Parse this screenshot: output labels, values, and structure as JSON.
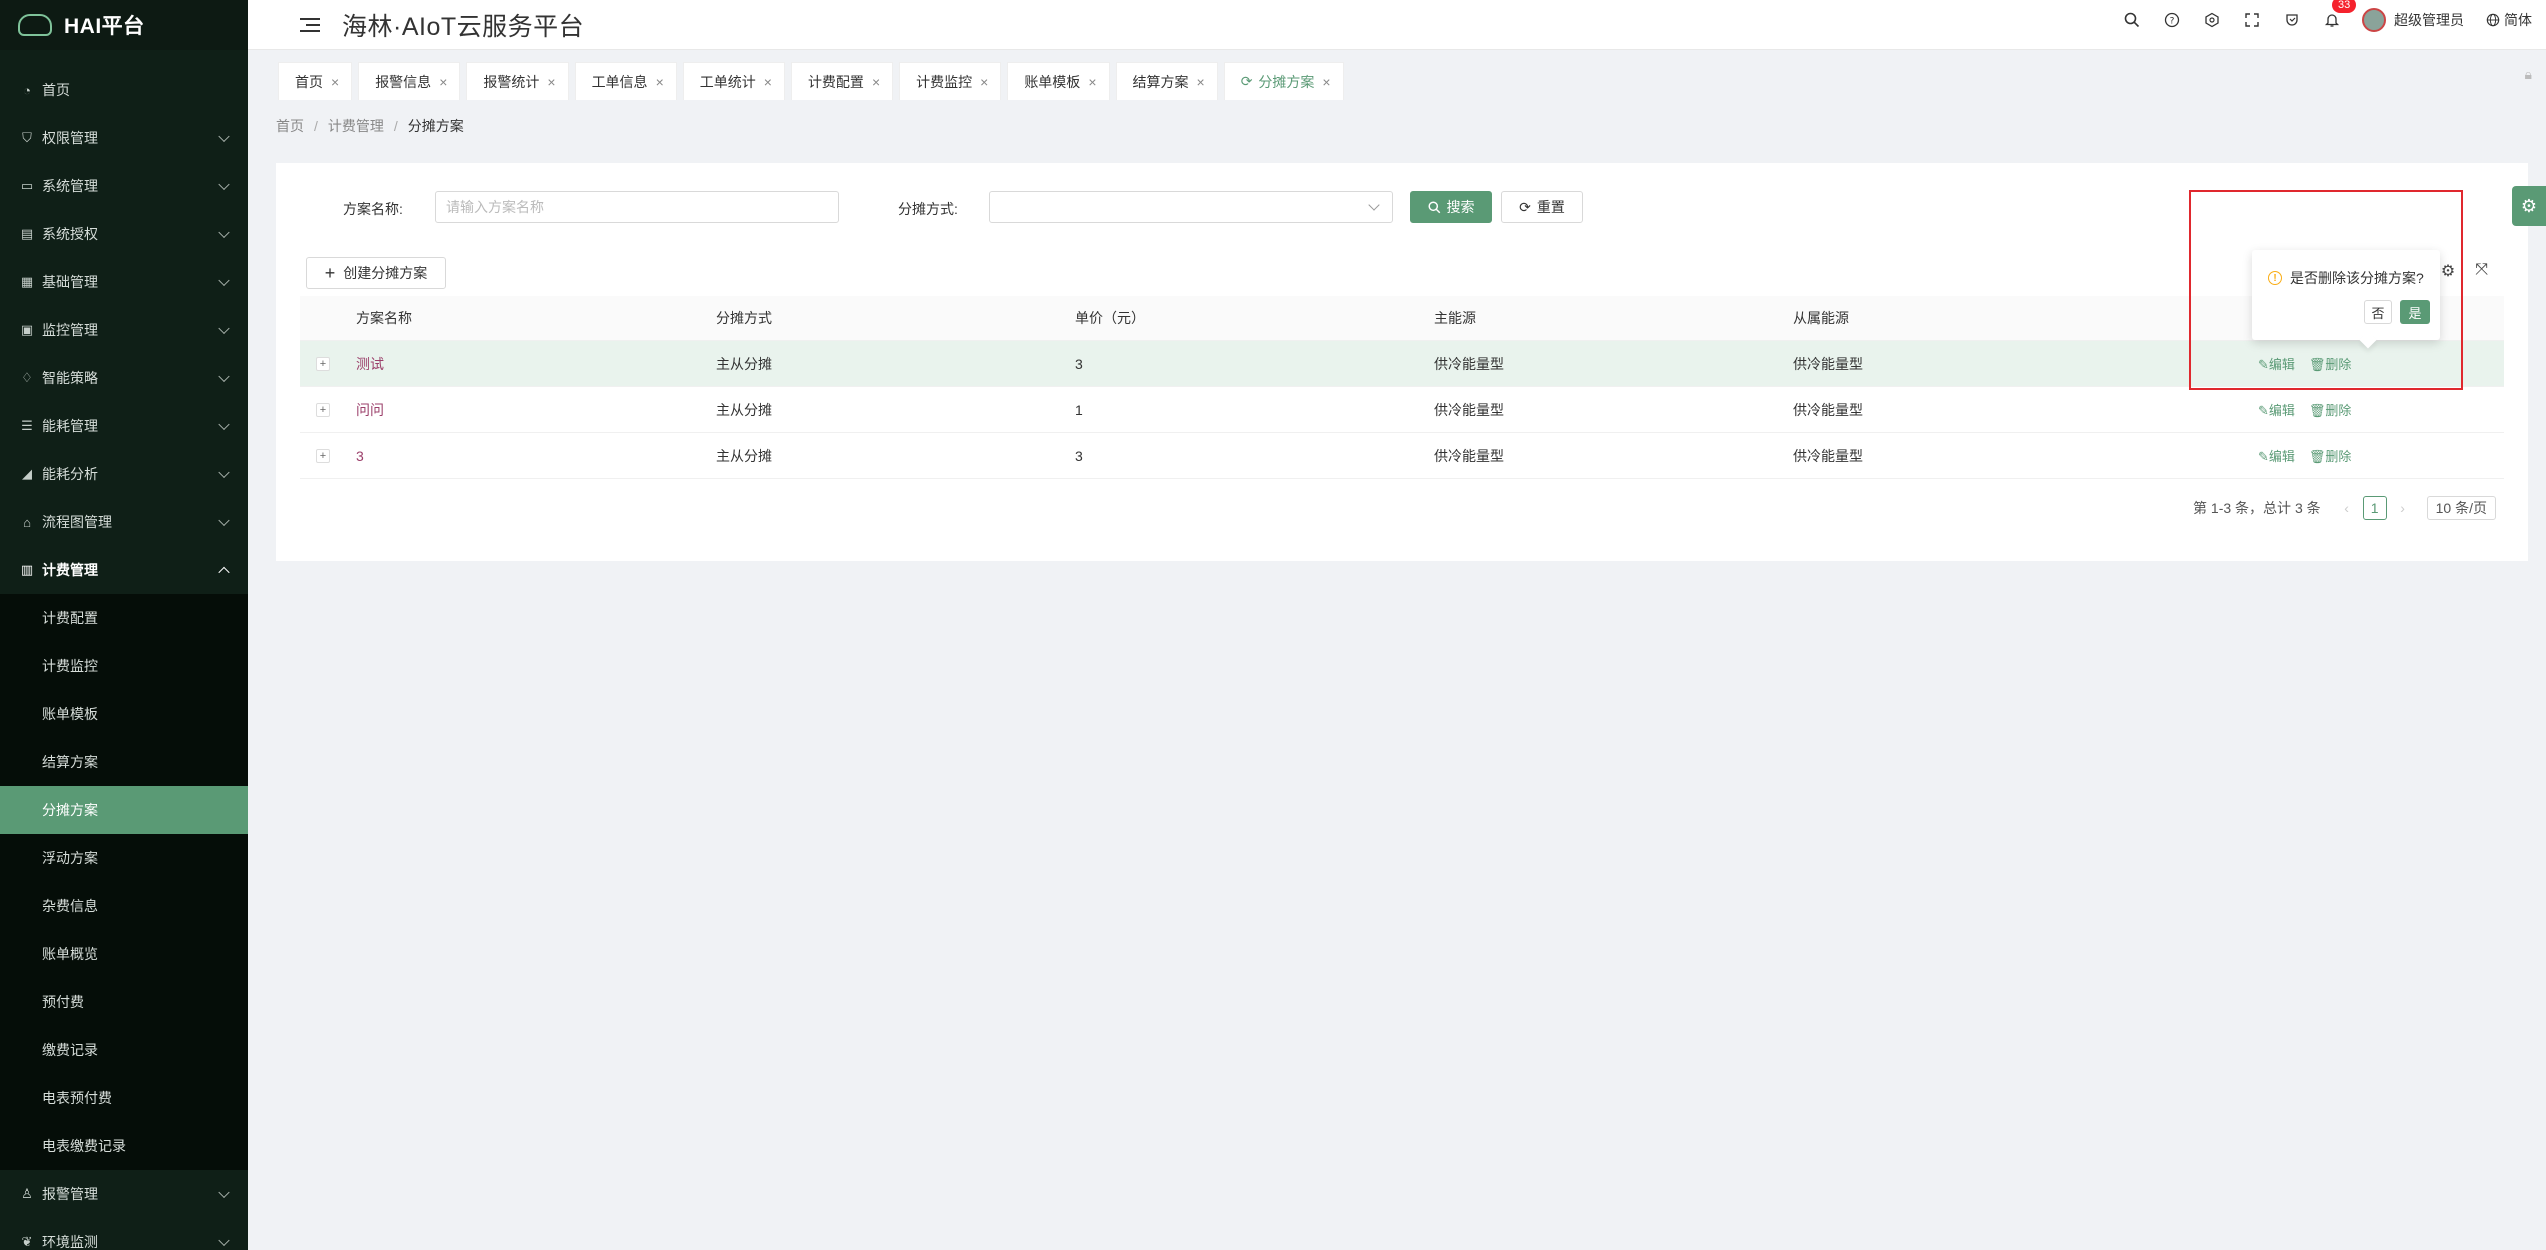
{
  "app": {
    "logo_text": "HAI平台",
    "title": "海林·AIoT云服务平台"
  },
  "header": {
    "notification_count": "33",
    "user_name": "超级管理员",
    "language": "简体",
    "icons": [
      "search-icon",
      "help-icon",
      "settings-cube-icon",
      "fullscreen-icon",
      "theme-icon",
      "bell-icon"
    ]
  },
  "sidebar": {
    "items": [
      {
        "label": "首页",
        "icon": "dashboard-icon"
      },
      {
        "label": "权限管理",
        "icon": "shield-icon"
      },
      {
        "label": "系统管理",
        "icon": "desktop-icon"
      },
      {
        "label": "系统授权",
        "icon": "license-icon"
      },
      {
        "label": "基础管理",
        "icon": "database-icon"
      },
      {
        "label": "监控管理",
        "icon": "monitor-icon"
      },
      {
        "label": "智能策略",
        "icon": "bulb-icon"
      },
      {
        "label": "能耗管理",
        "icon": "list-icon"
      },
      {
        "label": "能耗分析",
        "icon": "chart-icon"
      },
      {
        "label": "流程图管理",
        "icon": "flow-icon"
      },
      {
        "label": "计费管理",
        "icon": "billing-icon"
      }
    ],
    "billing_sub": [
      "计费配置",
      "计费监控",
      "账单模板",
      "结算方案",
      "分摊方案",
      "浮动方案",
      "杂费信息",
      "账单概览",
      "预付费",
      "缴费记录",
      "电表预付费",
      "电表缴费记录"
    ],
    "after": [
      {
        "label": "报警管理",
        "icon": "alarm-icon"
      },
      {
        "label": "环境监测",
        "icon": "leaf-icon"
      }
    ]
  },
  "tabs": [
    {
      "label": "首页"
    },
    {
      "label": "报警信息"
    },
    {
      "label": "报警统计"
    },
    {
      "label": "工单信息"
    },
    {
      "label": "工单统计"
    },
    {
      "label": "计费配置"
    },
    {
      "label": "计费监控"
    },
    {
      "label": "账单模板"
    },
    {
      "label": "结算方案"
    },
    {
      "label": "分摊方案"
    }
  ],
  "breadcrumb": [
    "首页",
    "计费管理",
    "分摊方案"
  ],
  "filter": {
    "name_label": "方案名称:",
    "name_placeholder": "请输入方案名称",
    "method_label": "分摊方式:",
    "search_label": "搜索",
    "reset_label": "重置"
  },
  "create_label": "创建分摊方案",
  "table": {
    "headers": [
      "方案名称",
      "分摊方式",
      "单价（元）",
      "主能源",
      "从属能源"
    ],
    "rows": [
      {
        "name": "测试",
        "method": "主从分摊",
        "price": "3",
        "main": "供冷能量型",
        "sub": "供冷能量型"
      },
      {
        "name": "问问",
        "method": "主从分摊",
        "price": "1",
        "main": "供冷能量型",
        "sub": "供冷能量型"
      },
      {
        "name": "3",
        "method": "主从分摊",
        "price": "3",
        "main": "供冷能量型",
        "sub": "供冷能量型"
      }
    ],
    "edit_label": "编辑",
    "delete_label": "删除"
  },
  "pagination": {
    "summary": "第 1-3 条，总计 3 条",
    "current": "1",
    "size": "10 条/页"
  },
  "popconfirm": {
    "message": "是否删除该分摊方案?",
    "cancel": "否",
    "ok": "是"
  },
  "colors": {
    "accent": "#5a9a75",
    "sidebar": "#0f1f17",
    "highlight": "#e0282e"
  }
}
